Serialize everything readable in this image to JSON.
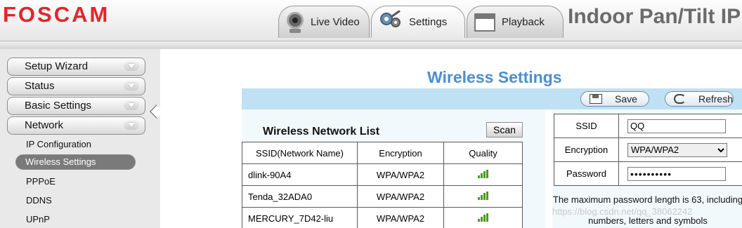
{
  "header": {
    "logo": "FOSCAM",
    "product_title": "Indoor Pan/Tilt IP",
    "tabs": [
      {
        "label": "Live Video",
        "icon": "camera-icon"
      },
      {
        "label": "Settings",
        "icon": "gears-icon"
      },
      {
        "label": "Playback",
        "icon": "calendar-icon"
      }
    ],
    "active_tab": "Settings"
  },
  "sidebar": {
    "menus": [
      {
        "label": "Setup Wizard"
      },
      {
        "label": "Status"
      },
      {
        "label": "Basic Settings"
      },
      {
        "label": "Network"
      }
    ],
    "network_items": [
      {
        "label": "IP Configuration"
      },
      {
        "label": "Wireless Settings"
      },
      {
        "label": "PPPoE"
      },
      {
        "label": "DDNS"
      },
      {
        "label": "UPnP"
      }
    ],
    "active_item": "Wireless Settings"
  },
  "main": {
    "title": "Wireless Settings",
    "toolbar": {
      "save_label": "Save",
      "refresh_label": "Refresh"
    },
    "list": {
      "title": "Wireless Network List",
      "scan_label": "Scan",
      "columns": [
        "SSID(Network Name)",
        "Encryption",
        "Quality"
      ],
      "rows": [
        {
          "ssid": "dlink-90A4",
          "encryption": "WPA/WPA2",
          "quality": "signal-icon"
        },
        {
          "ssid": "Tenda_32ADA0",
          "encryption": "WPA/WPA2",
          "quality": "signal-icon"
        },
        {
          "ssid": "MERCURY_7D42-liu",
          "encryption": "WPA/WPA2",
          "quality": "signal-icon"
        }
      ]
    },
    "config": {
      "ssid_label": "SSID",
      "ssid_value": "QQ",
      "encryption_label": "Encryption",
      "encryption_value": "WPA/WPA2",
      "password_label": "Password",
      "password_mask": "••••••••••",
      "note": "The maximum password length is 63, including numbers, letters and symbols"
    }
  },
  "watermark": "https://blog.csdn.net/qq_38062242",
  "colors": {
    "brand": "#e5242a",
    "title_blue": "#4a8ed4",
    "toolbar": "#bfe1f3",
    "signal": "#4c9a1c"
  }
}
